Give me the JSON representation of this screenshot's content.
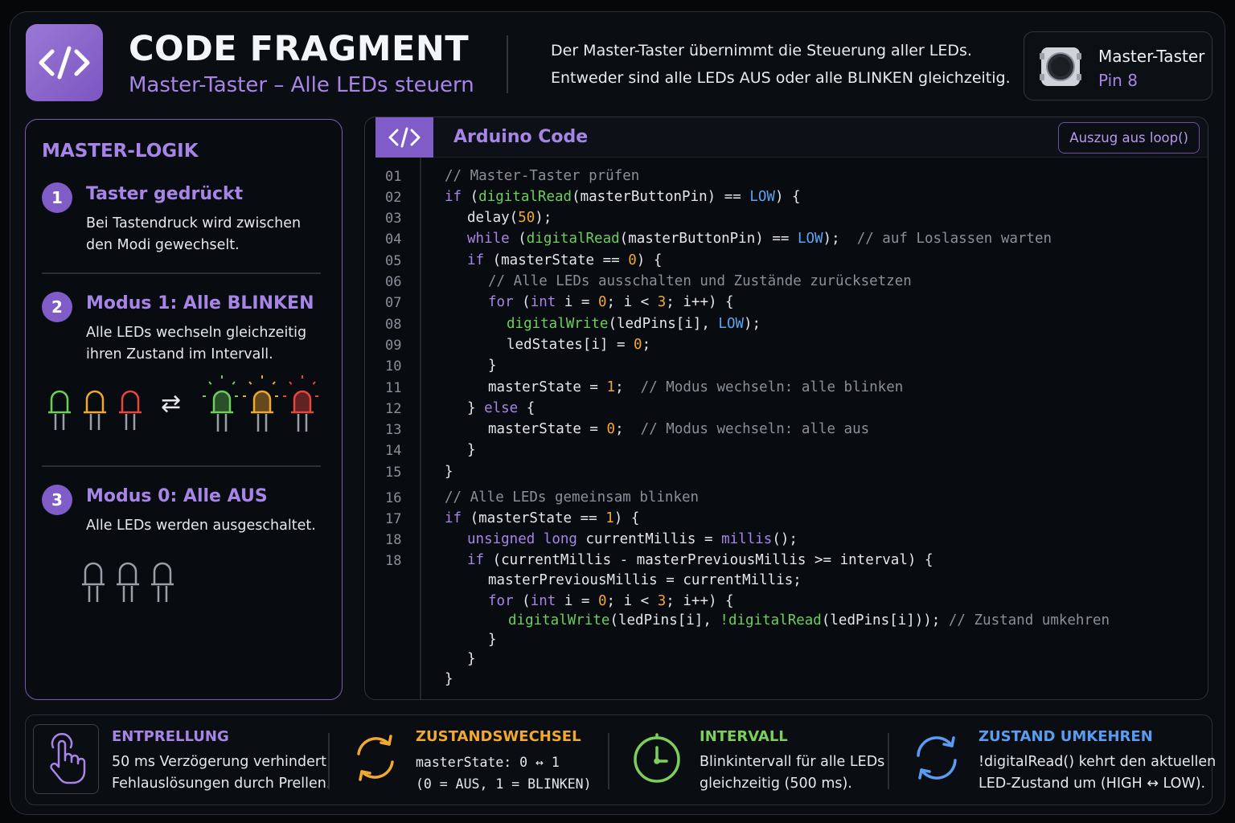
{
  "header": {
    "title": "CODE FRAGMENT",
    "subtitle": "Master-Taster – Alle LEDs steuern",
    "description_line1": "Der Master-Taster übernimmt die Steuerung aller LEDs.",
    "description_line2": "Entweder sind alle LEDs AUS oder alle BLINKEN gleichzeitig.",
    "logo_icon": "code-brackets-icon"
  },
  "pin_card": {
    "label": "Master-Taster",
    "value": "Pin 8",
    "icon": "push-button-icon"
  },
  "logic_panel": {
    "title": "MASTER-LOGIK",
    "steps": [
      {
        "number": "1",
        "title": "Taster gedrückt",
        "text_line1": "Bei Tastendruck wird zwischen",
        "text_line2": "den Modi gewechselt."
      },
      {
        "number": "2",
        "title": "Modus 1: Alle BLINKEN",
        "text_line1": "Alle LEDs wechseln gleichzeitig",
        "text_line2": "ihren Zustand im Intervall."
      },
      {
        "number": "3",
        "title": "Modus 0: Alle AUS",
        "text_line1": "Alle LEDs werden ausgeschaltet."
      }
    ],
    "swap_symbol": "⇄"
  },
  "code_panel": {
    "title": "Arduino Code",
    "badge": "Auszug aus loop()",
    "line_numbers": [
      "01",
      "02",
      "03",
      "04",
      "05",
      "06",
      "07",
      "08",
      "09",
      "10",
      "11",
      "12",
      "13",
      "14",
      "15",
      "16",
      "17",
      "18",
      "18"
    ]
  },
  "tips": [
    {
      "title": "ENTPRELLUNG",
      "line1": "50 ms Verzögerung verhindert",
      "line2": "Fehlauslösungen durch Prellen.",
      "icon": "finger-press-icon",
      "color": "#a785e6"
    },
    {
      "title": "ZUSTANDSWECHSEL",
      "line1": "masterState: 0 ↔ 1",
      "line2": "(0 = AUS, 1 = BLINKEN)",
      "icon": "cycle-arrows-icon",
      "color": "#f0a830"
    },
    {
      "title": "INTERVALL",
      "line1": "Blinkintervall für alle LEDs",
      "line2": "gleichzeitig (500 ms).",
      "icon": "clock-icon",
      "color": "#7ccf5a"
    },
    {
      "title": "ZUSTAND UMKEHREN",
      "line1": "!digitalRead() kehrt den aktuellen",
      "line2": "LED-Zustand um (HIGH ↔ LOW).",
      "icon": "refresh-icon",
      "color": "#5a9df0"
    }
  ],
  "colors": {
    "accent": "#a785e6",
    "accent_fill": "#7f5cc8",
    "led_green": "#6ccf5c",
    "led_amber": "#f0a830",
    "led_red": "#e8453c"
  }
}
